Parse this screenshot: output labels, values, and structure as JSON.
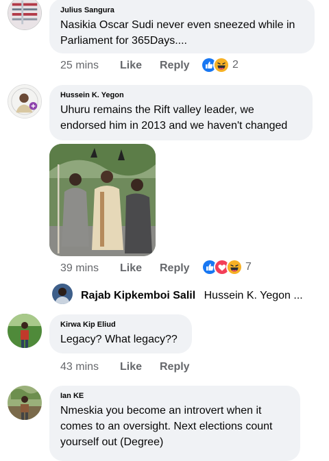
{
  "comments": [
    {
      "author": "Julius Sangura",
      "text": "Nasikia Oscar Sudi never even sneezed while in Parliament for 365Days....",
      "time": "25 mins",
      "like_label": "Like",
      "reply_label": "Reply",
      "reaction_count": "2"
    },
    {
      "author": "Hussein K. Yegon",
      "text": "Uhuru remains the Rift valley leader, we endorsed him in 2013 and we haven't changed",
      "time": "39 mins",
      "like_label": "Like",
      "reply_label": "Reply",
      "reaction_count": "7"
    },
    {
      "author": "Kirwa Kip Eliud",
      "text": "Legacy? What legacy??",
      "time": "43 mins",
      "like_label": "Like",
      "reply_label": "Reply"
    },
    {
      "author": "Ian KE",
      "text": "Nmeskia you become an introvert when it comes to an oversight. Next elections count yourself out (Degree)"
    }
  ],
  "reply_preview": {
    "author": "Rajab Kipkemboi Salil",
    "text": "Hussein K. Yegon ..."
  },
  "icons": {
    "like_reaction": "thumbs-up-icon",
    "haha_reaction": "laughing-face-icon",
    "love_reaction": "heart-icon"
  },
  "colors": {
    "like_blue": "#1877f2",
    "love_red": "#f33e58",
    "haha_yellow": "#f7b125",
    "bubble_bg": "#f0f2f5",
    "meta_gray": "#65676b"
  }
}
